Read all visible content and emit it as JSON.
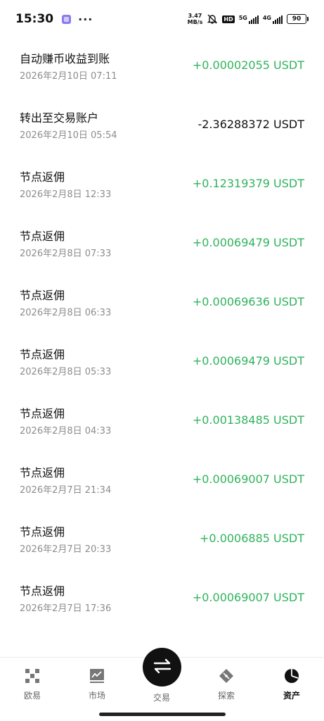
{
  "status_bar": {
    "time": "15:30",
    "dots": "···",
    "speed_value": "3.47",
    "speed_unit": "MB/s",
    "hd_label": "HD",
    "net5g": "5G",
    "net4g": "4G",
    "battery": "90"
  },
  "records": [
    {
      "title": "自动赚币收益到账",
      "time": "2026年2月10日 07:11",
      "amount": "+0.00002055 USDT",
      "direction": "in"
    },
    {
      "title": "转出至交易账户",
      "time": "2026年2月10日 05:54",
      "amount": "-2.36288372 USDT",
      "direction": "out"
    },
    {
      "title": "节点返佣",
      "time": "2026年2月8日 12:33",
      "amount": "+0.12319379 USDT",
      "direction": "in"
    },
    {
      "title": "节点返佣",
      "time": "2026年2月8日 07:33",
      "amount": "+0.00069479 USDT",
      "direction": "in"
    },
    {
      "title": "节点返佣",
      "time": "2026年2月8日 06:33",
      "amount": "+0.00069636 USDT",
      "direction": "in"
    },
    {
      "title": "节点返佣",
      "time": "2026年2月8日 05:33",
      "amount": "+0.00069479 USDT",
      "direction": "in"
    },
    {
      "title": "节点返佣",
      "time": "2026年2月8日 04:33",
      "amount": "+0.00138485 USDT",
      "direction": "in"
    },
    {
      "title": "节点返佣",
      "time": "2026年2月7日 21:34",
      "amount": "+0.00069007 USDT",
      "direction": "in"
    },
    {
      "title": "节点返佣",
      "time": "2026年2月7日 20:33",
      "amount": "+0.0006885 USDT",
      "direction": "in"
    },
    {
      "title": "节点返佣",
      "time": "2026年2月7日 17:36",
      "amount": "+0.00069007 USDT",
      "direction": "in"
    }
  ],
  "nav": {
    "home": "欧易",
    "market": "市场",
    "trade": "交易",
    "explore": "探索",
    "assets": "资产",
    "active": "assets"
  },
  "colors": {
    "positive": "#2fb35c",
    "negative": "#111111",
    "secondary_text": "#8c8c8c"
  }
}
